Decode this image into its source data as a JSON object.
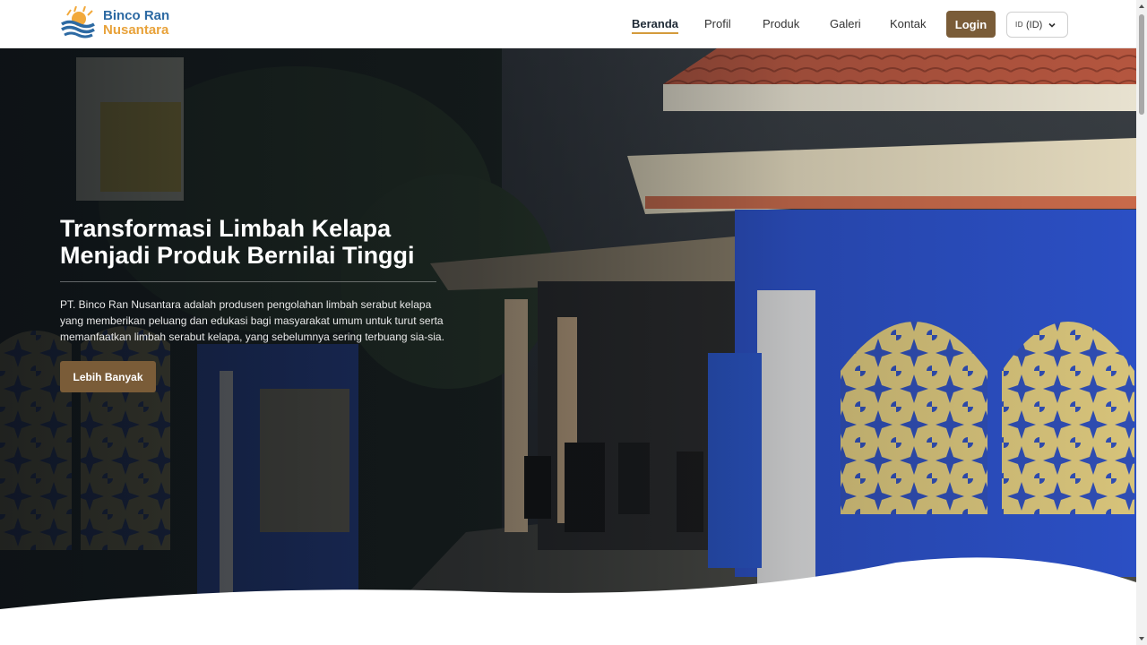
{
  "brand": {
    "line1": "Binco Ran",
    "line2": "Nusantara",
    "logo_icon": "sun-waves-logo"
  },
  "nav": {
    "links": [
      {
        "label": "Beranda",
        "active": true
      },
      {
        "label": "Profil",
        "active": false
      },
      {
        "label": "Produk",
        "active": false
      },
      {
        "label": "Galeri",
        "active": false
      },
      {
        "label": "Kontak",
        "active": false
      }
    ],
    "login_label": "Login",
    "language": {
      "code": "ID",
      "label": "(ID)",
      "icon": "chevron-down-icon"
    }
  },
  "hero": {
    "title_line1": "Transformasi Limbah Kelapa",
    "title_line2": "Menjadi Produk Bernilai Tinggi",
    "description": "PT. Binco Ran Nusantara adalah produsen pengolahan limbah serabut kelapa yang memberikan peluang dan edukasi bagi masyarakat umum untuk turut serta memanfaatkan limbah serabut kelapa, yang sebelumnya sering terbuang sia-sia.",
    "cta_label": "Lebih Banyak"
  },
  "colors": {
    "primary_brown": "#7a5c38",
    "accent_gold": "#d49b3b",
    "brand_blue": "#2d6aa3",
    "brand_orange": "#e8a23a"
  }
}
